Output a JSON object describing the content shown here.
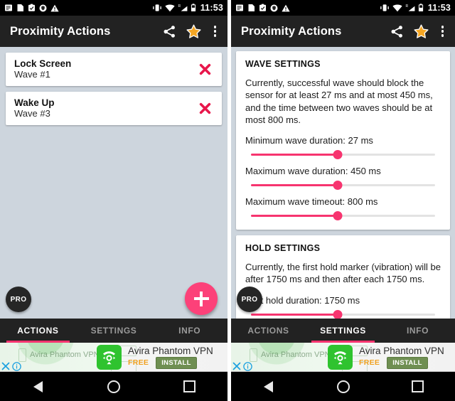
{
  "status_bar": {
    "time": "11:53",
    "left_icons": [
      "message-icon",
      "page-icon",
      "clipboard-check-icon",
      "shield-icon",
      "warning-icon"
    ],
    "right_icons": [
      "vibrate-icon",
      "wifi-icon",
      "roaming-signal-icon",
      "battery-icon"
    ]
  },
  "app_bar": {
    "title": "Proximity Actions",
    "actions": [
      "share-icon",
      "star-icon",
      "overflow-menu-icon"
    ]
  },
  "colors": {
    "accent_pink": "#f7346f",
    "fab_pink": "#fc4179",
    "delete_red": "#e8174b",
    "star_orange": "#f5a623",
    "appbar_dark": "#222222",
    "page_bg": "#cdd5dd"
  },
  "left_screen": {
    "actions": [
      {
        "title": "Lock Screen",
        "subtitle": "Wave #1",
        "delete": "delete-icon"
      },
      {
        "title": "Wake Up",
        "subtitle": "Wave #3",
        "delete": "delete-icon"
      }
    ],
    "pro_badge": "PRO",
    "fab_label": "add-action",
    "tabs": [
      {
        "label": "ACTIONS",
        "active": true
      },
      {
        "label": "SETTINGS",
        "active": false
      },
      {
        "label": "INFO",
        "active": false
      }
    ]
  },
  "right_screen": {
    "cards": [
      {
        "heading": "WAVE SETTINGS",
        "description": "Currently, successful wave should block the sensor for at least 27 ms and at most 450 ms, and the time between two waves should be at most 800 ms.",
        "sliders": [
          {
            "label": "Minimum wave duration: 27 ms",
            "value": 27,
            "unit": "ms",
            "percent": 47
          },
          {
            "label": "Maximum wave duration: 450 ms",
            "value": 450,
            "unit": "ms",
            "percent": 47
          },
          {
            "label": "Maximum wave timeout: 800 ms",
            "value": 800,
            "unit": "ms",
            "percent": 47
          }
        ]
      },
      {
        "heading": "HOLD SETTINGS",
        "description": "Currently, the first hold marker (vibration) will be after 1750 ms and then after each 1750 ms.",
        "sliders": [
          {
            "label": "First hold duration: 1750 ms",
            "value": 1750,
            "unit": "ms",
            "percent": 47
          }
        ]
      }
    ],
    "pro_badge": "PRO",
    "tabs": [
      {
        "label": "ACTIONS",
        "active": false
      },
      {
        "label": "SETTINGS",
        "active": true
      },
      {
        "label": "INFO",
        "active": false
      }
    ]
  },
  "ad": {
    "ghost_title": "Avira Phantom VPN",
    "title": "Avira Phantom VPN",
    "price": "FREE",
    "cta": "INSTALL",
    "close": "close-ad-icon",
    "info": "ad-info-icon"
  },
  "nav_bar": {
    "back": "back-triangle-icon",
    "home": "home-circle-icon",
    "recents": "recents-square-icon"
  }
}
